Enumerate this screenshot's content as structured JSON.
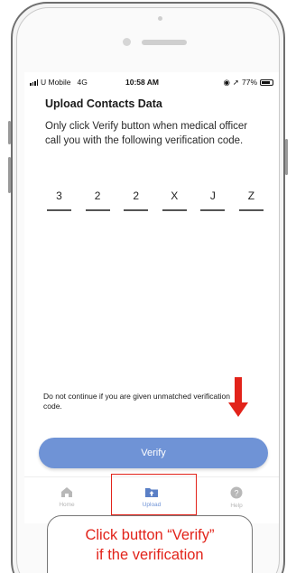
{
  "status_bar": {
    "carrier": "U Mobile",
    "network": "4G",
    "time": "10:58 AM",
    "battery_percent": "77%"
  },
  "screen": {
    "title": "Upload Contacts Data",
    "instruction": "Only click Verify button when medical officer call you with the following verification code.",
    "verification_code": [
      "3",
      "2",
      "2",
      "X",
      "J",
      "Z"
    ],
    "warning": "Do not continue if you are given unmatched verification code.",
    "verify_button_label": "Verify"
  },
  "tab_bar": {
    "items": [
      {
        "label": "Home",
        "icon": "home-icon",
        "active": false
      },
      {
        "label": "Upload",
        "icon": "upload-folder-icon",
        "active": true
      },
      {
        "label": "Help",
        "icon": "help-icon",
        "active": false
      }
    ]
  },
  "annotation": {
    "callout_line_1": "Click button “Verify”",
    "callout_line_2": "if the verification",
    "accent_color": "#e2231a"
  },
  "colors": {
    "primary_button": "#6f93d6",
    "annotation_red": "#e2231a"
  }
}
